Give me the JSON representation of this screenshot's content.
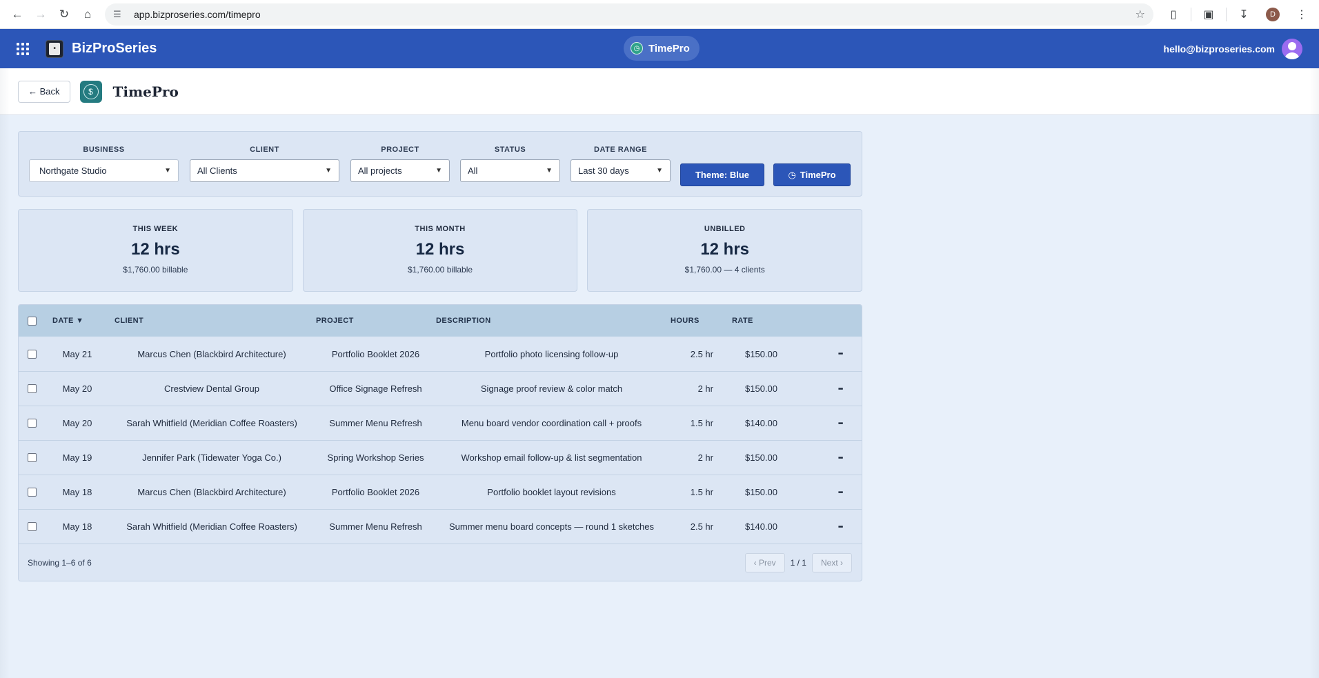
{
  "browser": {
    "url": "app.bizproseries.com/timepro",
    "profile_initial": "D"
  },
  "app_header": {
    "brand": "BizProSeries",
    "app_pill": "TimePro",
    "user_email": "hello@bizproseries.com"
  },
  "title_bar": {
    "back_label": "← Back",
    "title": "TimePro"
  },
  "filters": {
    "business": {
      "label": "BUSINESS",
      "value": "Northgate Studio"
    },
    "client": {
      "label": "CLIENT",
      "value": "All Clients"
    },
    "project": {
      "label": "PROJECT",
      "value": "All projects"
    },
    "status": {
      "label": "STATUS",
      "value": "All"
    },
    "date_range": {
      "label": "DATE RANGE",
      "value": "Last 30 days"
    },
    "theme_button": "Theme: Blue",
    "timepro_button": "TimePro"
  },
  "stats": [
    {
      "label": "THIS WEEK",
      "value": "12 hrs",
      "sub": "$1,760.00 billable"
    },
    {
      "label": "THIS MONTH",
      "value": "12 hrs",
      "sub": "$1,760.00 billable"
    },
    {
      "label": "UNBILLED",
      "value": "12 hrs",
      "sub": "$1,760.00 — 4 clients"
    }
  ],
  "table": {
    "headers": {
      "date": "DATE ▼",
      "client": "CLIENT",
      "project": "PROJECT",
      "description": "DESCRIPTION",
      "hours": "HOURS",
      "rate": "RATE"
    },
    "rows": [
      {
        "date": "May 21",
        "client": "Marcus Chen (Blackbird Architecture)",
        "project": "Portfolio Booklet 2026",
        "description": "Portfolio photo licensing follow-up",
        "hours": "2.5 hr",
        "rate": "$150.00"
      },
      {
        "date": "May 20",
        "client": "Crestview Dental Group",
        "project": "Office Signage Refresh",
        "description": "Signage proof review & color match",
        "hours": "2 hr",
        "rate": "$150.00"
      },
      {
        "date": "May 20",
        "client": "Sarah Whitfield (Meridian Coffee Roasters)",
        "project": "Summer Menu Refresh",
        "description": "Menu board vendor coordination call + proofs",
        "hours": "1.5 hr",
        "rate": "$140.00"
      },
      {
        "date": "May 19",
        "client": "Jennifer Park (Tidewater Yoga Co.)",
        "project": "Spring Workshop Series",
        "description": "Workshop email follow-up & list segmentation",
        "hours": "2 hr",
        "rate": "$150.00"
      },
      {
        "date": "May 18",
        "client": "Marcus Chen (Blackbird Architecture)",
        "project": "Portfolio Booklet 2026",
        "description": "Portfolio booklet layout revisions",
        "hours": "1.5 hr",
        "rate": "$150.00"
      },
      {
        "date": "May 18",
        "client": "Sarah Whitfield (Meridian Coffee Roasters)",
        "project": "Summer Menu Refresh",
        "description": "Summer menu board concepts — round 1 sketches",
        "hours": "2.5 hr",
        "rate": "$140.00"
      }
    ],
    "footer": {
      "showing": "Showing 1–6 of 6",
      "prev": "‹ Prev",
      "page": "1 / 1",
      "next": "Next ›"
    }
  },
  "colors": {
    "header_blue": "#2c56b8",
    "panel_bg": "#dce6f4",
    "table_header_bg": "#b7cfe3",
    "page_bg": "#e8f0fa"
  }
}
